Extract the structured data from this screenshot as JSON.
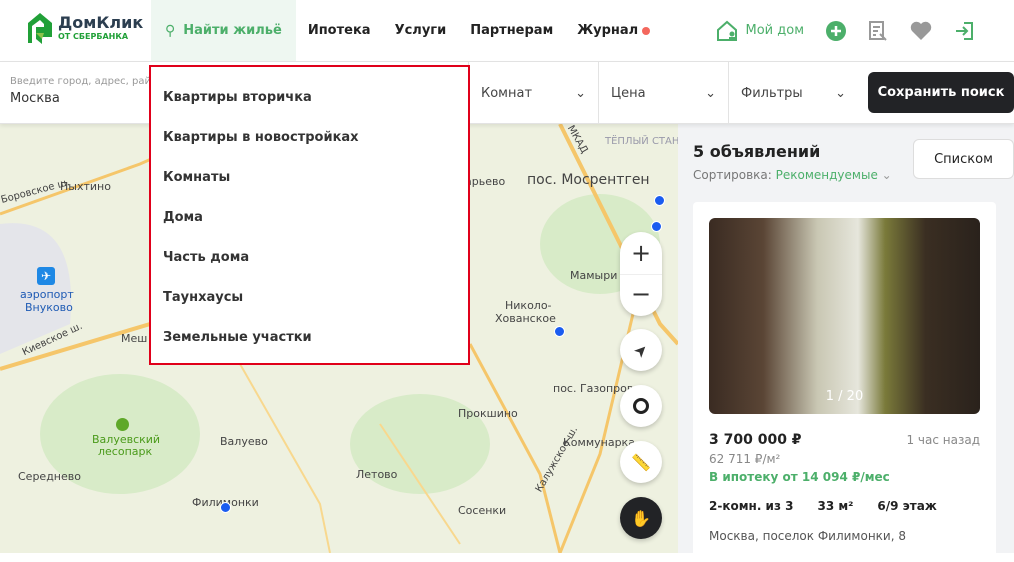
{
  "header": {
    "logo_name": "ДомКлик",
    "logo_sub": "ОТ СБЕРБАНКА",
    "nav": [
      {
        "label": "Найти жильё"
      },
      {
        "label": "Ипотека"
      },
      {
        "label": "Услуги"
      },
      {
        "label": "Партнерам"
      },
      {
        "label": "Журнал"
      }
    ],
    "my_home": "Мой дом"
  },
  "filters": {
    "address_placeholder": "Введите город, адрес, район",
    "address_value": "Москва",
    "rooms": "Комнат",
    "price": "Цена",
    "more": "Фильтры",
    "save": "Сохранить поиск"
  },
  "dropdown": {
    "items": [
      "Квартиры вторичка",
      "Квартиры в новостройках",
      "Комнаты",
      "Дома",
      "Часть дома",
      "Таунхаусы",
      "Земельные участки"
    ]
  },
  "map": {
    "labels": [
      "пос. Мосрентген",
      "ТЁПЛЫЙ СТАН",
      "Пыхтино",
      "аэропорт",
      "Внуково",
      "Киевское ш.",
      "Меш",
      "Мамыри",
      "Николо-",
      "Хованское",
      "пос. Газопровод",
      "Прокшино",
      "Валуевский",
      "лесопарк",
      "Валуево",
      "Коммунарка",
      "Середнево",
      "Летово",
      "Филимонки",
      "Сосенки",
      "Калужское ш.",
      "МКАД",
      "арьево",
      "Боровское ш.",
      "Киевское ш."
    ]
  },
  "results": {
    "count": "5 объявлений",
    "sort_label": "Сортировка:",
    "sort_value": "Рекомендуемые",
    "list_button": "Списком",
    "card": {
      "photo_counter": "1 / 20",
      "price": "3 700 000 ₽",
      "time": "1 час назад",
      "price_per_m": "62 711 ₽/м²",
      "mortgage": "В ипотеку от 14 094 ₽/мес",
      "rooms": "2-комн. из 3",
      "area": "33 м²",
      "floor": "6/9 этаж",
      "address": "Москва, поселок Филимонки, 8"
    }
  },
  "colors": {
    "accent": "#4caf6a",
    "dark": "#222326",
    "highlight": "#e0001a",
    "pin": "#1a5cf0"
  }
}
